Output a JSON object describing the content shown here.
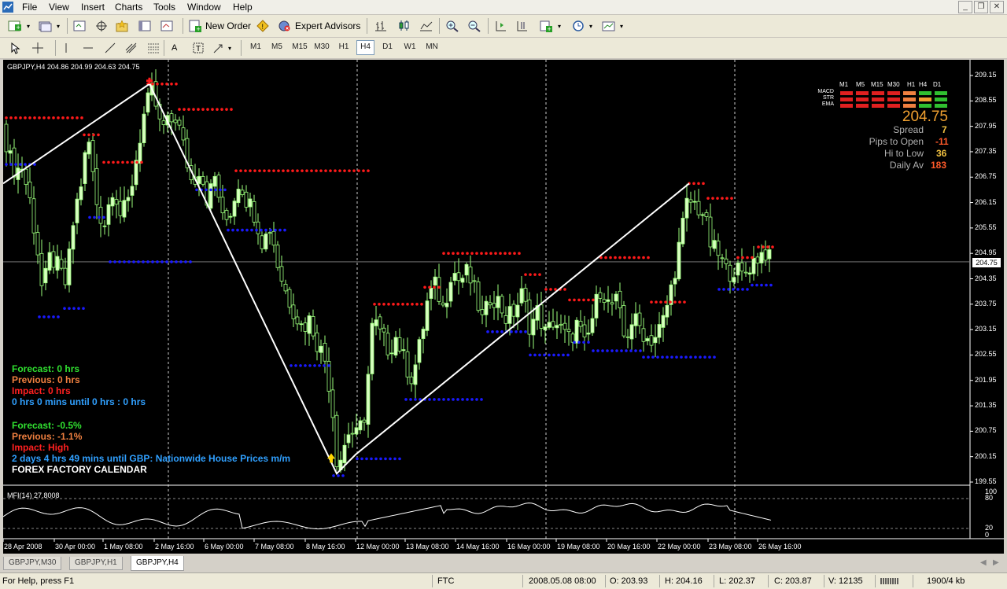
{
  "menubar": {
    "items": [
      "File",
      "View",
      "Insert",
      "Charts",
      "Tools",
      "Window",
      "Help"
    ]
  },
  "toolbar": {
    "new_order_label": "New Order",
    "expert_advisors_label": "Expert Advisors",
    "timeframes": [
      "M1",
      "M5",
      "M15",
      "M30",
      "H1",
      "H4",
      "D1",
      "W1",
      "MN"
    ],
    "active_timeframe": "H4"
  },
  "chart": {
    "symbol_info": "GBPJPY,H4  204.86 204.99 204.63 204.75",
    "mfi_label": "MFI(14) 27.8008",
    "current_price": "204.75",
    "price_ticks": [
      "209.15",
      "208.55",
      "207.95",
      "207.35",
      "206.75",
      "206.15",
      "205.55",
      "204.95",
      "204.35",
      "203.75",
      "203.15",
      "202.55",
      "201.95",
      "201.35",
      "200.75",
      "200.15",
      "199.55"
    ],
    "mfi_ticks": [
      "100",
      "80",
      "20",
      "0"
    ],
    "date_ticks": [
      "28 Apr 2008",
      "30 Apr 00:00",
      "1 May 08:00",
      "2 May 16:00",
      "6 May 00:00",
      "7 May 08:00",
      "8 May 16:00",
      "12 May 00:00",
      "13 May 08:00",
      "14 May 16:00",
      "16 May 00:00",
      "19 May 08:00",
      "20 May 16:00",
      "22 May 00:00",
      "23 May 08:00",
      "26 May 16:00"
    ]
  },
  "indicator_panel": {
    "timeframes": [
      "M1",
      "M5",
      "M15",
      "M30",
      "H1",
      "H4",
      "D1"
    ],
    "rows": [
      "MACD",
      "STR",
      "EMA"
    ],
    "big_price": "204.75",
    "stats": [
      {
        "label": "Spread",
        "value": "7",
        "color": "#f0c040"
      },
      {
        "label": "Pips to Open",
        "value": "-11",
        "color": "#ff5a2a"
      },
      {
        "label": "Hi to Low",
        "value": "36",
        "color": "#f0c040"
      },
      {
        "label": "Daily Av",
        "value": "183",
        "color": "#ff5a2a"
      }
    ],
    "colors": {
      "green": "#30c030",
      "red": "#e02020",
      "orange": "#f08040",
      "gold": "#f0a030"
    }
  },
  "forex_factory": {
    "block1": {
      "forecast": "Forecast: 0 hrs",
      "previous": "Previous: 0 hrs",
      "impact": "Impact: 0 hrs",
      "countdown": "0 hrs 0 mins until 0 hrs : 0 hrs"
    },
    "block2": {
      "forecast": "Forecast: -0.5%",
      "previous": "Previous: -1.1%",
      "impact": "Impact: High",
      "countdown": "2 days 4 hrs 49 mins until GBP: Nationwide House Prices m/m"
    },
    "title": "FOREX FACTORY CALENDAR"
  },
  "tabs": [
    "GBPJPY,M30",
    "GBPJPY,H1",
    "GBPJPY,H4"
  ],
  "active_tab": "GBPJPY,H4",
  "statusbar": {
    "help": "For Help, press F1",
    "profile": "FTC",
    "time": "2008.05.08 08:00",
    "open": "O: 203.93",
    "high": "H: 204.16",
    "low": "L: 202.37",
    "close": "C: 203.87",
    "volume": "V: 12135",
    "traffic": "1900/4 kb"
  },
  "colors": {
    "bull_candle": "#d8ffc0",
    "bear_candle": "#000000",
    "wick": "#9cff7c",
    "red_dots": "#ff1a1a",
    "blue_dots": "#1a1aff",
    "zigzag": "#ffffff",
    "ff_green": "#30e030",
    "ff_orange": "#f08040",
    "ff_red": "#ff2020",
    "ff_blue": "#30a0ff"
  }
}
